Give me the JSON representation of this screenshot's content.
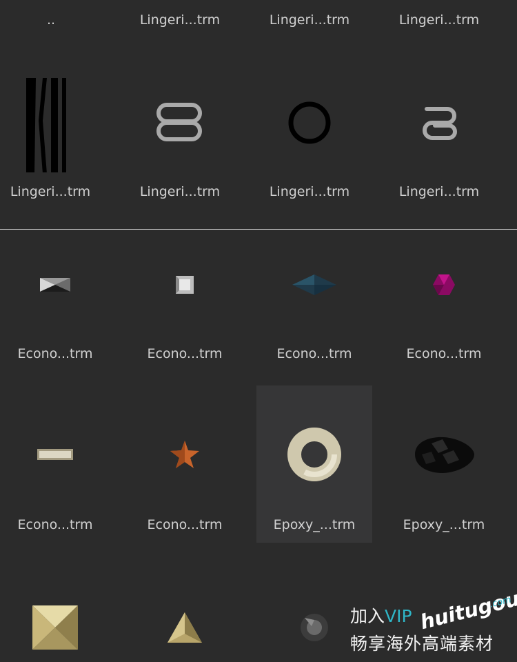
{
  "browser": {
    "header_row": [
      {
        "label": ".."
      },
      {
        "label": "Lingeri...trm"
      },
      {
        "label": "Lingeri...trm"
      },
      {
        "label": "Lingeri...trm"
      }
    ],
    "lingerie_row": [
      {
        "label": "Lingeri...trm",
        "icon": "bra-strap-slider-icon"
      },
      {
        "label": "Lingeri...trm",
        "icon": "figure-eight-slider-icon"
      },
      {
        "label": "Lingeri...trm",
        "icon": "o-ring-icon"
      },
      {
        "label": "Lingeri...trm",
        "icon": "hook-slider-icon"
      }
    ],
    "economy_row_1": [
      {
        "label": "Econo...trm",
        "icon": "rectangle-gem-icon"
      },
      {
        "label": "Econo...trm",
        "icon": "square-stud-icon"
      },
      {
        "label": "Econo...trm",
        "icon": "marquise-gem-icon"
      },
      {
        "label": "Econo...trm",
        "icon": "hexagon-gem-icon"
      }
    ],
    "economy_row_2": [
      {
        "label": "Econo...trm",
        "icon": "bar-stud-icon"
      },
      {
        "label": "Econo...trm",
        "icon": "star-stud-icon"
      },
      {
        "label": "Epoxy_...trm",
        "icon": "torus-bead-icon",
        "selected": true
      },
      {
        "label": "Epoxy_...trm",
        "icon": "pear-gem-icon"
      }
    ],
    "bottom_row": [
      {
        "icon": "pyramid-stud-icon"
      },
      {
        "icon": "triangle-stud-icon"
      },
      {
        "icon": "round-gem-icon"
      }
    ]
  },
  "watermark": {
    "join": "加入",
    "vip": "VIP",
    "brand": "huitugou",
    "domain": ".com",
    "slogan": "畅享海外高端素材"
  }
}
